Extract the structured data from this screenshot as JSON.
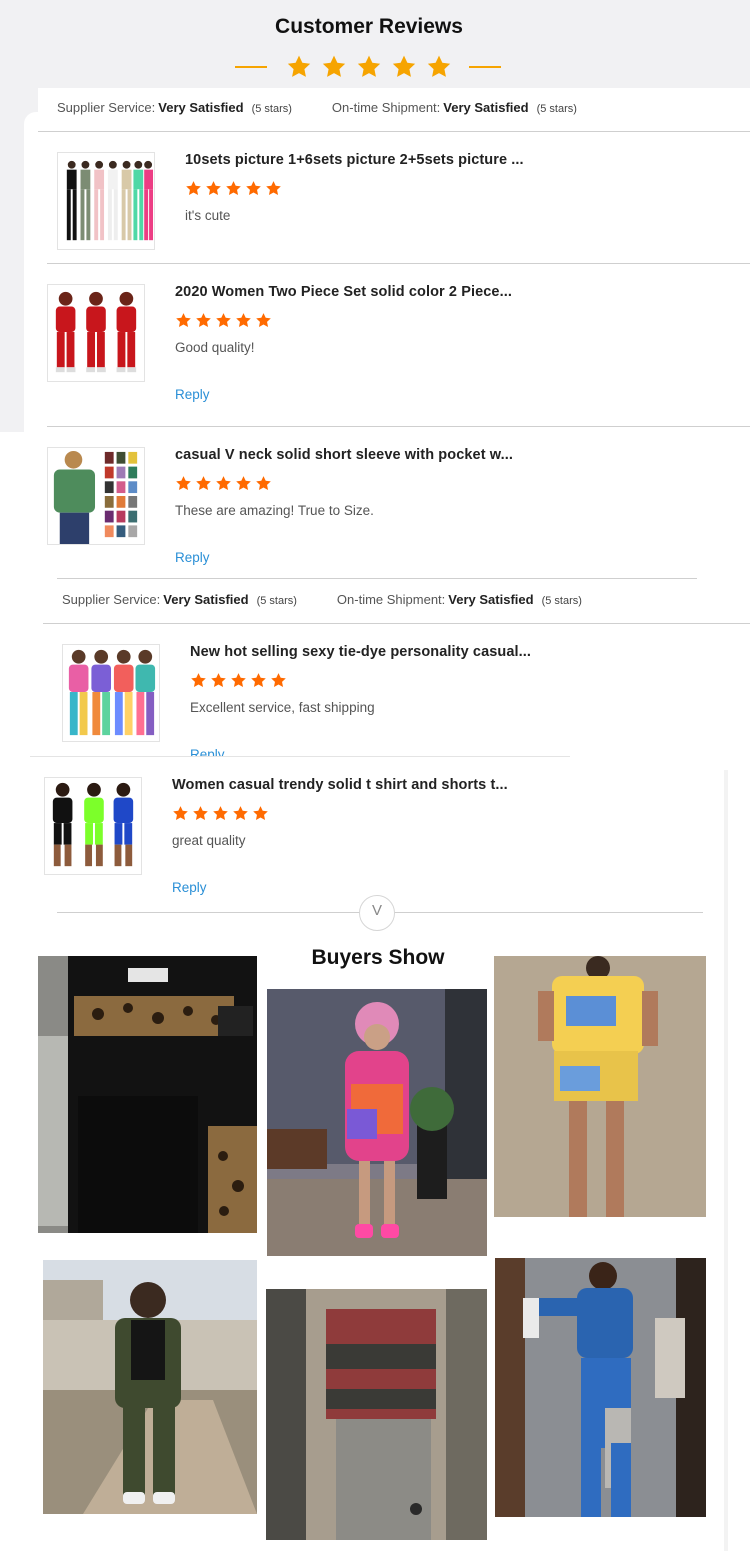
{
  "header": {
    "title": "Customer Reviews",
    "rating": 5
  },
  "service_bar": {
    "supplier_label": "Supplier Service:",
    "supplier_value": "Very Satisfied",
    "supplier_stars": "(5 stars)",
    "shipment_label": "On-time Shipment:",
    "shipment_value": "Very Satisfied",
    "shipment_stars": "(5 stars)"
  },
  "reviews": [
    {
      "title": "10sets picture 1+6sets picture 2+5sets picture ...",
      "rating": 5,
      "text": "it's cute",
      "reply": ""
    },
    {
      "title": "2020 Women Two Piece Set solid color 2 Piece...",
      "rating": 5,
      "text": "Good quality!",
      "reply": "Reply"
    },
    {
      "title": "casual V neck solid short sleeve with pocket w...",
      "rating": 5,
      "text": "These are amazing! True to Size.",
      "reply": "Reply"
    },
    {
      "title": "New hot selling sexy tie-dye personality casual...",
      "rating": 5,
      "text": "Excellent service, fast shipping",
      "reply": "Reply"
    },
    {
      "title": "Women casual trendy solid t shirt and shorts t...",
      "rating": 5,
      "text": "great quality",
      "reply": "Reply"
    }
  ],
  "expand": {
    "icon": "chevron-down-icon",
    "glyph": "V"
  },
  "buyers_show": {
    "title": "Buyers Show",
    "photo_count": 6
  },
  "colors": {
    "accent_star": "#f6a400",
    "review_star": "#ff6a00",
    "reply_link": "#2a8fd6"
  }
}
